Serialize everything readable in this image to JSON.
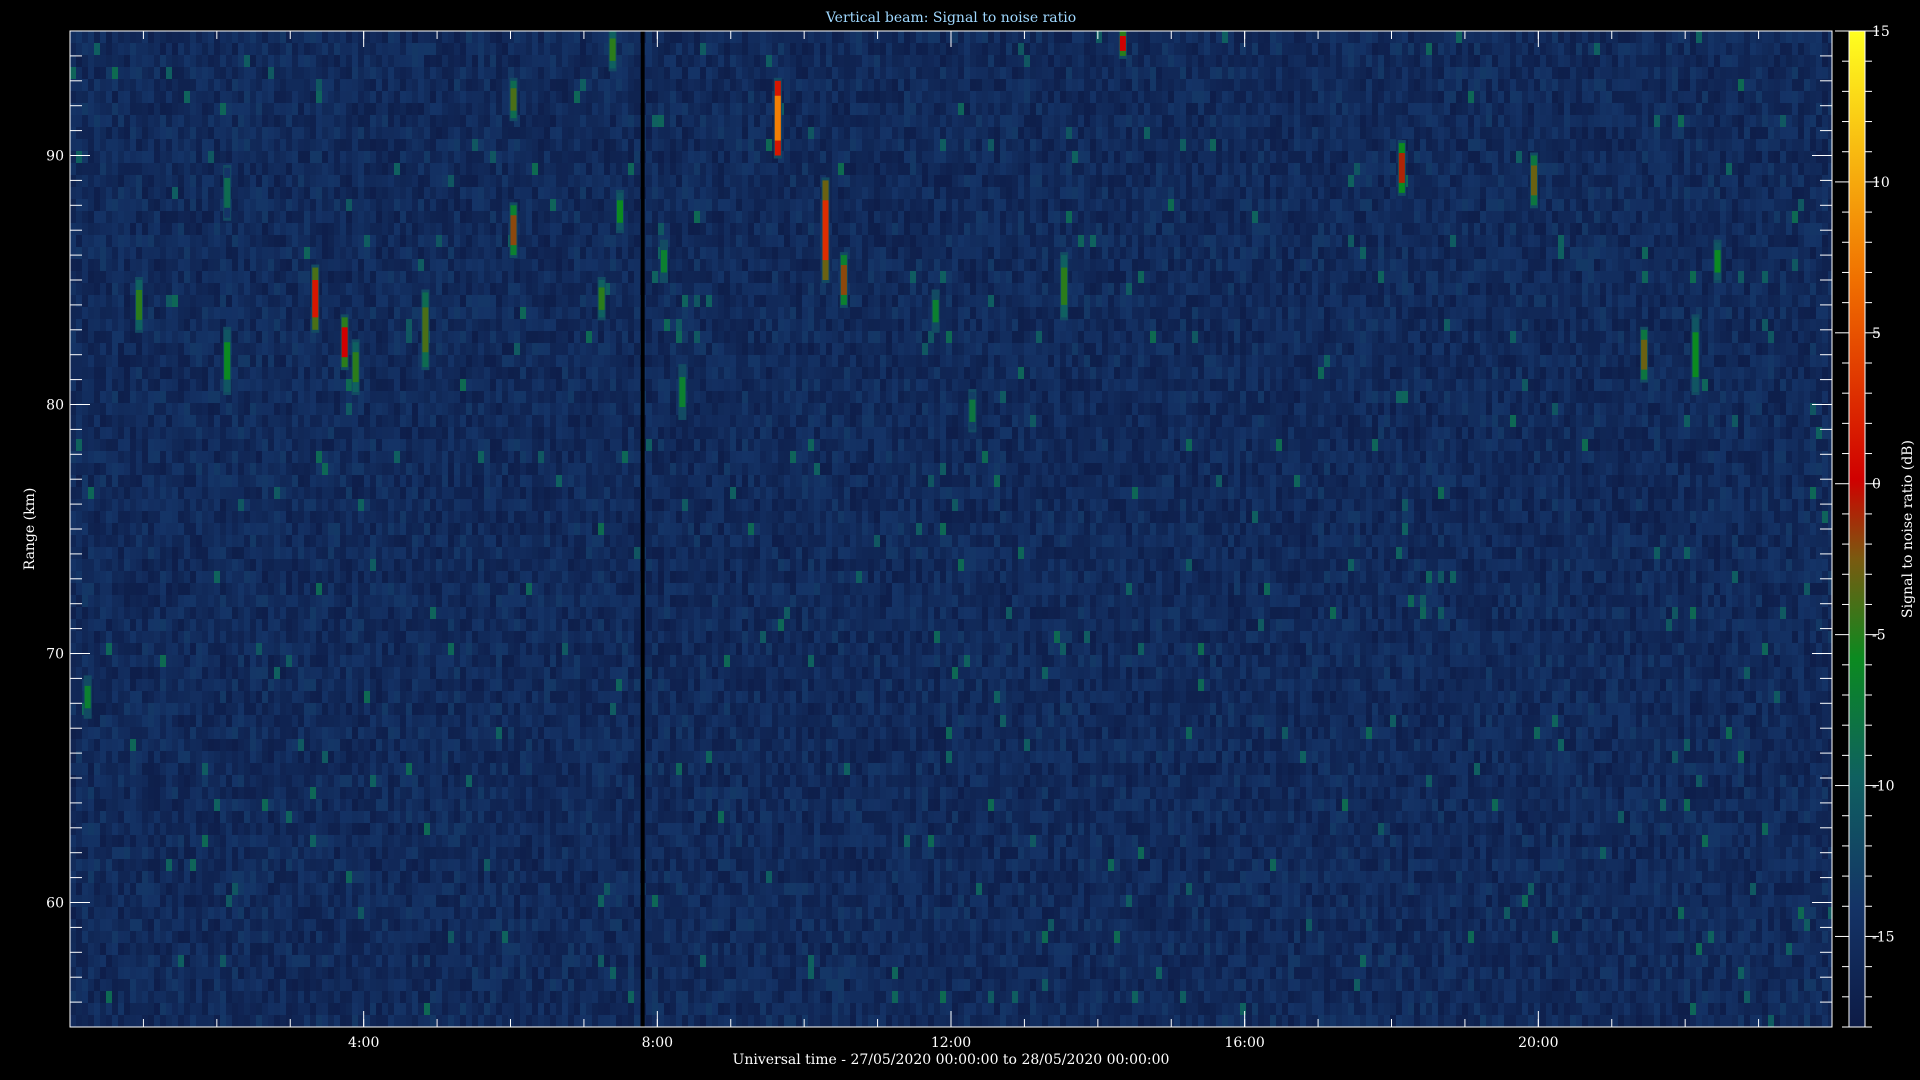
{
  "chart_data": {
    "type": "heatmap",
    "title": "Vertical beam: Signal to noise ratio",
    "xlabel": "Universal time - 27/05/2020 00:00:00 to 28/05/2020 00:00:00",
    "ylabel": "Range (km)",
    "colorbar_label": "Signal to noise ratio (dB)",
    "xlim_hours": [
      0,
      24
    ],
    "ylim_km": [
      55,
      95
    ],
    "xticks": [
      {
        "value": 4,
        "label": "4:00"
      },
      {
        "value": 8,
        "label": "8:00"
      },
      {
        "value": 12,
        "label": "12:00"
      },
      {
        "value": 16,
        "label": "16:00"
      },
      {
        "value": 20,
        "label": "20:00"
      }
    ],
    "yticks": [
      {
        "value": 60,
        "label": "60"
      },
      {
        "value": 70,
        "label": "70"
      },
      {
        "value": 80,
        "label": "80"
      },
      {
        "value": 90,
        "label": "90"
      }
    ],
    "colorbar_range_db": [
      -18,
      15
    ],
    "colorbar_ticks": [
      {
        "value": 15,
        "label": "15"
      },
      {
        "value": 10,
        "label": "10"
      },
      {
        "value": 5,
        "label": "5"
      },
      {
        "value": 0,
        "label": "0"
      },
      {
        "value": -5,
        "label": "-5"
      },
      {
        "value": -10,
        "label": "-10"
      },
      {
        "value": -15,
        "label": "-15"
      }
    ],
    "background_level_db": -15,
    "data_gap_hour": 7.8,
    "echoes": [
      {
        "t": 0.2,
        "r0": 67.5,
        "r1": 69,
        "snr": -7
      },
      {
        "t": 0.9,
        "r0": 83,
        "r1": 85,
        "snr": -5
      },
      {
        "t": 2.1,
        "r0": 87.5,
        "r1": 89.5,
        "snr": -9
      },
      {
        "t": 2.1,
        "r0": 80.5,
        "r1": 83,
        "snr": -6
      },
      {
        "t": 3.3,
        "r0": 83,
        "r1": 85.5,
        "snr": 1
      },
      {
        "t": 3.7,
        "r0": 81.5,
        "r1": 83.5,
        "snr": 0
      },
      {
        "t": 3.85,
        "r0": 80.5,
        "r1": 82.5,
        "snr": -5
      },
      {
        "t": 4.8,
        "r0": 81.5,
        "r1": 84.5,
        "snr": -4
      },
      {
        "t": 6.0,
        "r0": 86,
        "r1": 88,
        "snr": -2
      },
      {
        "t": 6.0,
        "r0": 91.5,
        "r1": 93,
        "snr": -4
      },
      {
        "t": 7.2,
        "r0": 83.5,
        "r1": 85,
        "snr": -5
      },
      {
        "t": 7.35,
        "r0": 93.5,
        "r1": 95,
        "snr": -5
      },
      {
        "t": 7.45,
        "r0": 87,
        "r1": 88.5,
        "snr": -6
      },
      {
        "t": 8.05,
        "r0": 85,
        "r1": 86.5,
        "snr": -7
      },
      {
        "t": 8.3,
        "r0": 79.5,
        "r1": 81.5,
        "snr": -7
      },
      {
        "t": 9.6,
        "r0": 90,
        "r1": 93,
        "snr": 6
      },
      {
        "t": 10.25,
        "r0": 85,
        "r1": 89,
        "snr": 2
      },
      {
        "t": 10.5,
        "r0": 84,
        "r1": 86,
        "snr": -2
      },
      {
        "t": 11.75,
        "r0": 83,
        "r1": 84.5,
        "snr": -7
      },
      {
        "t": 12.25,
        "r0": 79,
        "r1": 80.5,
        "snr": -8
      },
      {
        "t": 13.5,
        "r0": 83.5,
        "r1": 86,
        "snr": -5
      },
      {
        "t": 14.3,
        "r0": 94,
        "r1": 95,
        "snr": 0
      },
      {
        "t": 18.1,
        "r0": 88.5,
        "r1": 90.5,
        "snr": -1
      },
      {
        "t": 19.9,
        "r0": 88,
        "r1": 90,
        "snr": -3
      },
      {
        "t": 21.4,
        "r0": 81,
        "r1": 83,
        "snr": -3
      },
      {
        "t": 22.1,
        "r0": 80.5,
        "r1": 83.5,
        "snr": -6
      },
      {
        "t": 22.4,
        "r0": 85,
        "r1": 86.5,
        "snr": -6
      }
    ]
  }
}
